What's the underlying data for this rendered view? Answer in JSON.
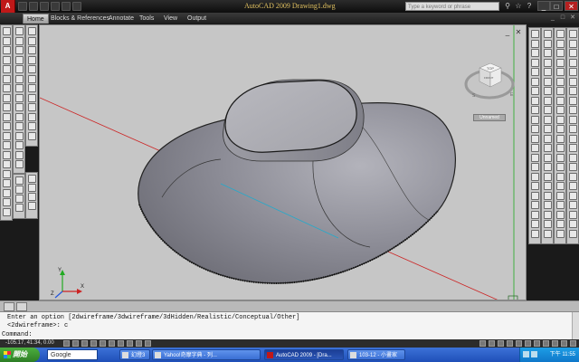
{
  "window": {
    "app_logo": "A",
    "title": "AutoCAD 2009  Drawing1.dwg",
    "search_placeholder": "Type a keyword or phrase"
  },
  "ribbon": {
    "tabs": [
      "Home",
      "Blocks & References",
      "Annotate",
      "Tools",
      "View",
      "Output"
    ],
    "active_tab": "Home"
  },
  "viewcube": {
    "face_top": "TOP",
    "face_front": "FRONT",
    "compass_s": "S",
    "compass_e": "E",
    "ucs_menu": "Unnamed"
  },
  "ucs_icon": {
    "x_label": "X",
    "y_label": "Y",
    "z_label": "Z"
  },
  "command": {
    "history_line1": "Enter an option [2dwireframe/3dwireframe/3dHidden/Realistic/Conceptual/Other]",
    "history_line2": "<2dwireframe>: c",
    "prompt": "Command:"
  },
  "status": {
    "coords": "-105.17, 41.34, 0.00"
  },
  "taskbar": {
    "start_label": "開始",
    "search_engine": "Google",
    "tasks": [
      {
        "label": "幻燈3"
      },
      {
        "label": "Yahoo!奇摩字典 - 列..."
      },
      {
        "label": "AutoCAD 2009 - [Dra..."
      },
      {
        "label": "103-12 - 小畫家"
      }
    ],
    "active_task_index": 2,
    "clock": "下午 11:55"
  },
  "colors": {
    "viewport_bg": "#c6c6c6",
    "model_face": "#8e8e98",
    "axis_red": "#cc2222",
    "axis_green": "#22aa22",
    "axis_cyan": "#22aacc",
    "taskbar_blue": "#245edb",
    "start_green": "#3f9a37",
    "autocad_red": "#c01818"
  }
}
